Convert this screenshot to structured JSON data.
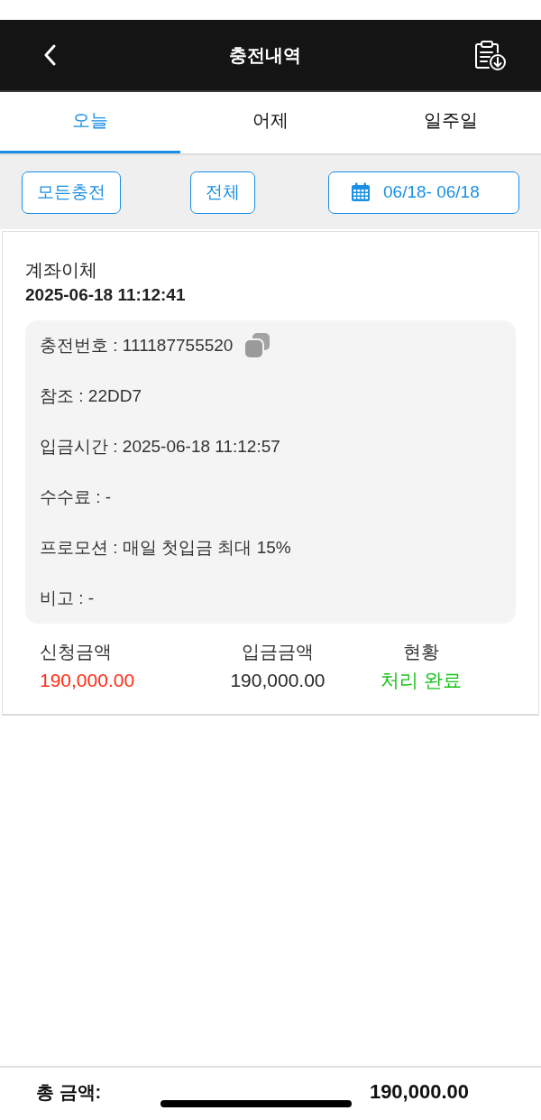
{
  "header": {
    "title": "충전내역"
  },
  "tabs": [
    {
      "label": "오늘",
      "selected": true
    },
    {
      "label": "어제",
      "selected": false
    },
    {
      "label": "일주일",
      "selected": false
    }
  ],
  "filters": {
    "type_button": "모든충전",
    "status_button": "전체",
    "date_range": "06/18- 06/18"
  },
  "records": [
    {
      "method": "계좌이체",
      "datetime": "2025-06-18 11:12:41",
      "details": [
        {
          "kind": "copyable",
          "text": "충전번호 : 111187755520"
        },
        {
          "kind": "plain",
          "text": "참조 : 22DD7"
        },
        {
          "kind": "plain",
          "text": "입금시간 : 2025-06-18 11:12:57"
        },
        {
          "kind": "plain",
          "text": "수수료 : -"
        },
        {
          "kind": "plain",
          "text": "프로모션 : 매일 첫입금 최대 15%"
        },
        {
          "kind": "plain",
          "text": "비고 : -"
        }
      ],
      "summary": [
        {
          "label": "신청금액",
          "value": "190,000.00",
          "color": "#ff2d14"
        },
        {
          "label": "입금금액",
          "value": "190,000.00",
          "color": "#2a2a2a"
        },
        {
          "label": "현황",
          "value": "처리 완료",
          "color": "#19c219"
        }
      ]
    }
  ],
  "footer": {
    "label": "총 금액:",
    "amount": "190,000.00"
  }
}
